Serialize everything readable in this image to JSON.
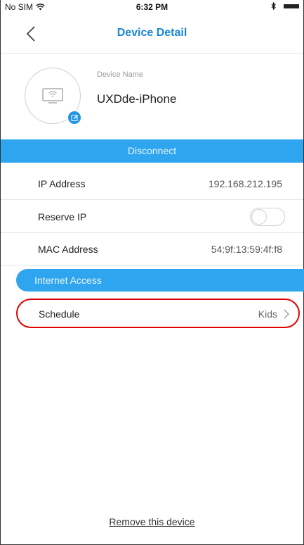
{
  "status_bar": {
    "carrier": "No SIM",
    "time": "6:32 PM"
  },
  "nav": {
    "title": "Device Detail"
  },
  "device": {
    "name_label": "Device Name",
    "name_value": "UXDde-iPhone"
  },
  "actions": {
    "disconnect_label": "Disconnect",
    "remove_label": "Remove this device"
  },
  "info": {
    "ip_label": "IP Address",
    "ip_value": "192.168.212.195",
    "reserve_label": "Reserve IP",
    "reserve_on": false,
    "mac_label": "MAC Address",
    "mac_value": "54:9f:13:59:4f:f8"
  },
  "internet": {
    "section_label": "Internet Access",
    "schedule_label": "Schedule",
    "schedule_value": "Kids"
  },
  "colors": {
    "accent": "#2ea5ee",
    "title": "#1a86d4",
    "highlight": "#e00000"
  }
}
